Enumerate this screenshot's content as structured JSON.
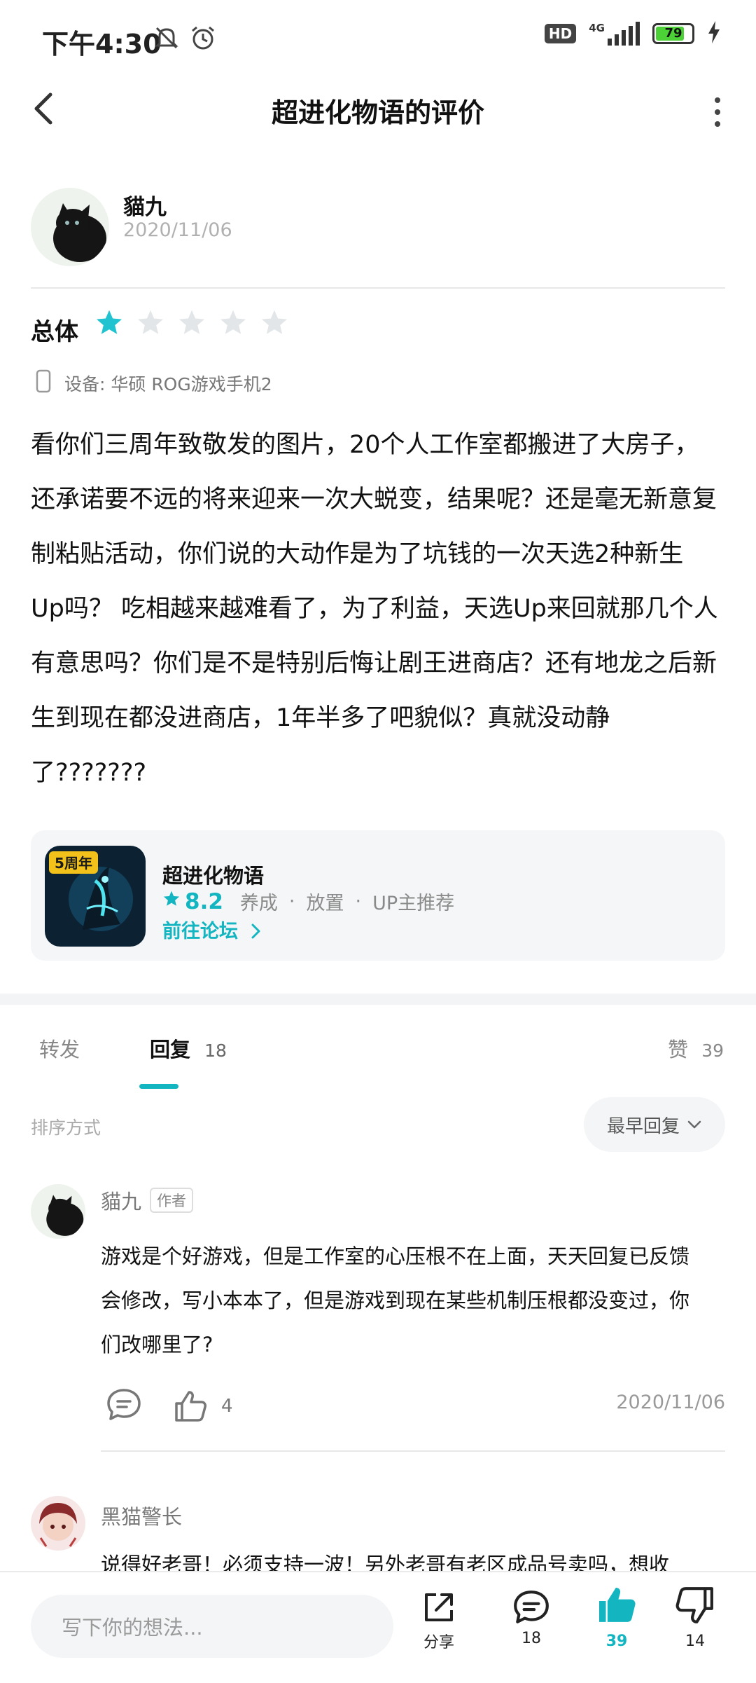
{
  "status_bar": {
    "time": "下午4:30",
    "hd": "HD",
    "network": "4G",
    "battery": "79",
    "battery_level": 0.79
  },
  "header": {
    "title": "超进化物语的评价"
  },
  "author": {
    "name": "貓九",
    "date": "2020/11/06"
  },
  "rating": {
    "label": "总体",
    "value": 1,
    "max": 5,
    "color": "#20c3cf"
  },
  "device": "设备: 华硕 ROG游戏手机2",
  "review": {
    "lines": [
      "看你们三周年致敬发的图片，20个人工作室都搬进了大房子，",
      "还承诺要不远的将来迎来一次大蜕变，结果呢？还是毫无新意复",
      "制粘贴活动，你们说的大动作是为了坑钱的一次天选2种新生",
      "Up吗？ 吃相越来越难看了，为了利益，天选Up来回就那几个人",
      "有意思吗？你们是不是特别后悔让剧王进商店？还有地龙之后新",
      "生到现在都没进商店，1年半多了吧貌似？真就没动静",
      "了???????"
    ]
  },
  "game": {
    "name": "超进化物语",
    "score": "8.2",
    "tags": [
      "养成",
      "放置",
      "UP主推荐"
    ],
    "forum_link": "前往论坛",
    "badge": "5周年"
  },
  "tabs": {
    "repost": "转发",
    "reply": "回复",
    "reply_count": "18",
    "like": "赞",
    "like_count": "39"
  },
  "sort": {
    "label": "排序方式",
    "value": "最早回复"
  },
  "comments": [
    {
      "name": "貓九",
      "tag": "作者",
      "lines": [
        "游戏是个好游戏，但是工作室的心压根不在上面，天天回复已反馈",
        "会修改，写小本本了，但是游戏到现在某些机制压根都没变过，你",
        "们改哪里了?"
      ],
      "likes": "4",
      "date": "2020/11/06"
    },
    {
      "name": "黑猫警长",
      "partial_text": "说得好老哥！必须支持一波！另外老哥有老区成品号卖吗，想收"
    }
  ],
  "bottom_bar": {
    "placeholder": "写下你的想法...",
    "share": "分享",
    "comments": "18",
    "likes": "39",
    "dislikes": "14",
    "accent": "#13b5c1"
  }
}
